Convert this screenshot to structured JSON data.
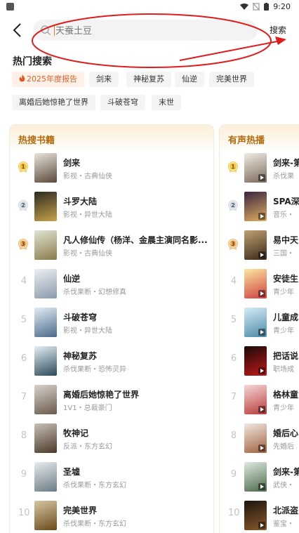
{
  "status": {
    "time": "9:20"
  },
  "search": {
    "placeholder": "天蚕土豆",
    "button": "搜索"
  },
  "hot_search": {
    "title": "热门搜索",
    "tags": [
      {
        "label": "2025年度报告",
        "hot": true
      },
      {
        "label": "剑来"
      },
      {
        "label": "神秘复苏"
      },
      {
        "label": "仙逆"
      },
      {
        "label": "完美世界"
      },
      {
        "label": "离婚后她惊艳了世界"
      },
      {
        "label": "斗破苍穹"
      },
      {
        "label": "末世"
      }
    ]
  },
  "hot_books": {
    "title": "热搜书籍",
    "items": [
      {
        "rank": "1",
        "title": "剑来",
        "sub": "影视・古典仙侠"
      },
      {
        "rank": "2",
        "title": "斗罗大陆",
        "sub": "影视・异世大陆"
      },
      {
        "rank": "3",
        "title": "凡人修仙传（杨洋、金晨主演同名影...",
        "sub": "影视・古典仙侠"
      },
      {
        "rank": "4",
        "title": "仙逆",
        "sub": "杀伐果断・幻想修真"
      },
      {
        "rank": "5",
        "title": "斗破苍穹",
        "sub": "影视・异世大陆"
      },
      {
        "rank": "6",
        "title": "神秘复苏",
        "sub": "杀伐果断・恐怖灵异"
      },
      {
        "rank": "7",
        "title": "离婚后她惊艳了世界",
        "sub": "1V1・总裁豪门"
      },
      {
        "rank": "8",
        "title": "牧神记",
        "sub": "反派・东方玄幻"
      },
      {
        "rank": "9",
        "title": "圣墟",
        "sub": "杀伐果断・东方玄幻"
      },
      {
        "rank": "10",
        "title": "完美世界",
        "sub": "杀伐果断・东方玄幻"
      }
    ]
  },
  "audio_hot": {
    "title": "有声热播",
    "items": [
      {
        "rank": "1",
        "title": "剑来-第",
        "sub": "杀伐果"
      },
      {
        "rank": "2",
        "title": "SPA深",
        "sub": "音乐・"
      },
      {
        "rank": "3",
        "title": "易中天",
        "sub": "三国・"
      },
      {
        "rank": "4",
        "title": "安徒生",
        "sub": "青少年"
      },
      {
        "rank": "5",
        "title": "儿童成",
        "sub": "青少年"
      },
      {
        "rank": "6",
        "title": "把话说",
        "sub": "职场成"
      },
      {
        "rank": "7",
        "title": "格林童",
        "sub": "青少年"
      },
      {
        "rank": "8",
        "title": "婚后心",
        "sub": "先婚后"
      },
      {
        "rank": "9",
        "title": "剑来-第",
        "sub": "武侠・"
      },
      {
        "rank": "10",
        "title": "北派盗",
        "sub": "鉴宝・"
      }
    ]
  },
  "colors": {
    "accent": "#f07a1a",
    "gold": "#b26b0e",
    "annotation": "#e01c1c"
  }
}
